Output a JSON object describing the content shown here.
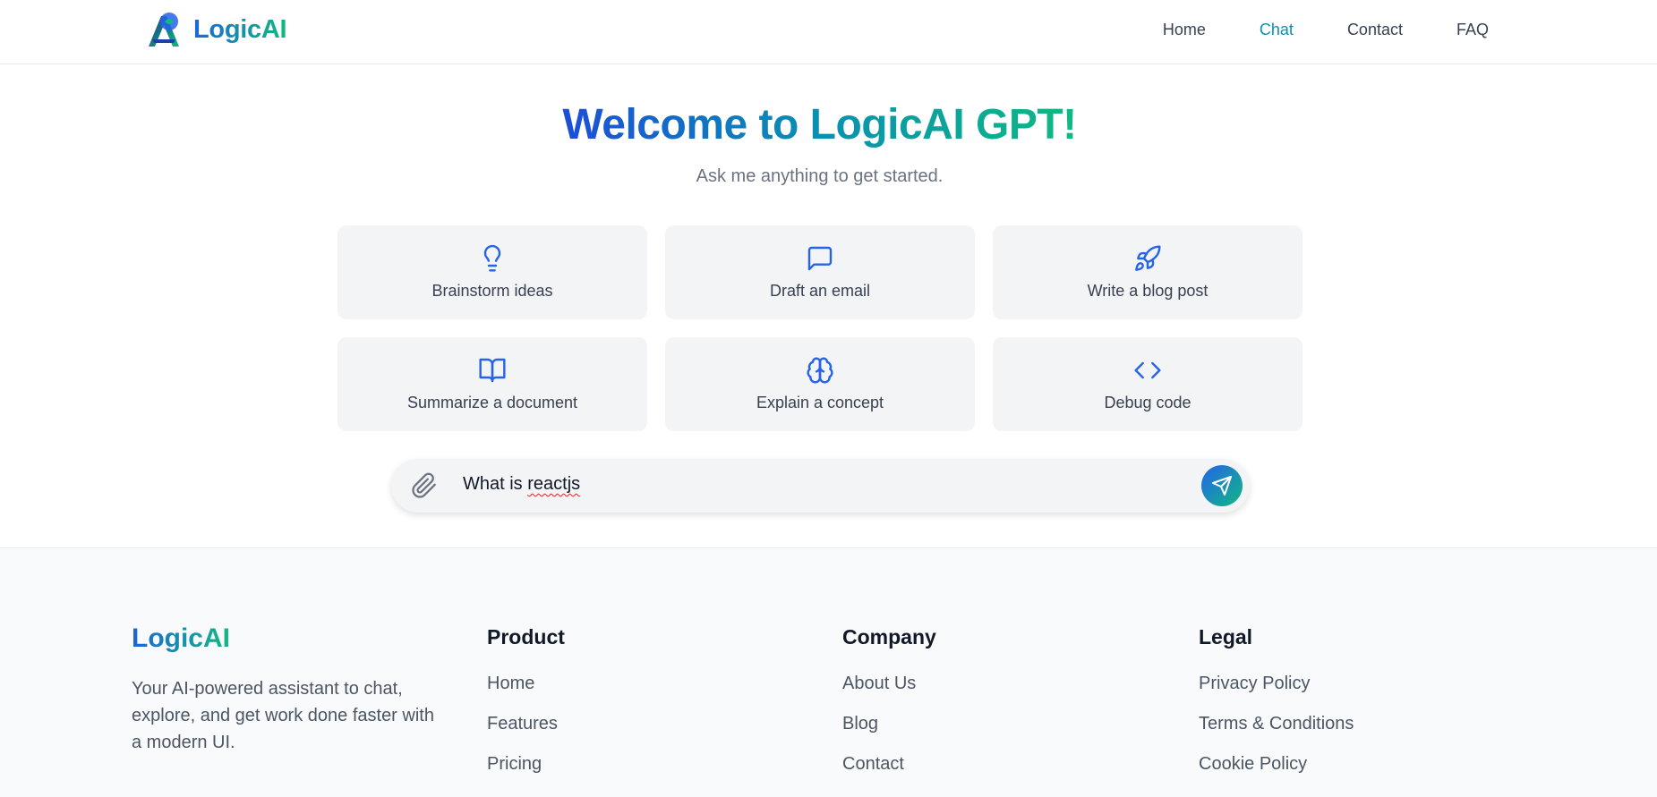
{
  "header": {
    "brand": "LogicAI",
    "nav": [
      {
        "label": "Home",
        "active": false
      },
      {
        "label": "Chat",
        "active": true
      },
      {
        "label": "Contact",
        "active": false
      },
      {
        "label": "FAQ",
        "active": false
      }
    ]
  },
  "hero": {
    "title": "Welcome to LogicAI GPT!",
    "subtitle": "Ask me anything to get started."
  },
  "suggestions": [
    {
      "label": "Brainstorm ideas",
      "icon": "lightbulb-icon"
    },
    {
      "label": "Draft an email",
      "icon": "message-square-icon"
    },
    {
      "label": "Write a blog post",
      "icon": "rocket-icon"
    },
    {
      "label": "Summarize a document",
      "icon": "book-open-icon"
    },
    {
      "label": "Explain a concept",
      "icon": "brain-icon"
    },
    {
      "label": "Debug code",
      "icon": "code-icon"
    }
  ],
  "chat": {
    "value_prefix": "What is ",
    "value_misspelled": "reactjs",
    "attach_icon": "paperclip-icon",
    "send_icon": "send-icon"
  },
  "footer": {
    "brand": "LogicAI",
    "description": "Your AI-powered assistant to chat, explore, and get work done faster with a modern UI.",
    "columns": [
      {
        "title": "Product",
        "links": [
          "Home",
          "Features",
          "Pricing"
        ]
      },
      {
        "title": "Company",
        "links": [
          "About Us",
          "Blog",
          "Contact"
        ]
      },
      {
        "title": "Legal",
        "links": [
          "Privacy Policy",
          "Terms & Conditions",
          "Cookie Policy"
        ]
      }
    ]
  },
  "colors": {
    "accent": "#2563eb",
    "accent_end": "#10b981",
    "nav_active": "#0891b2",
    "card_bg": "#f3f4f6"
  }
}
